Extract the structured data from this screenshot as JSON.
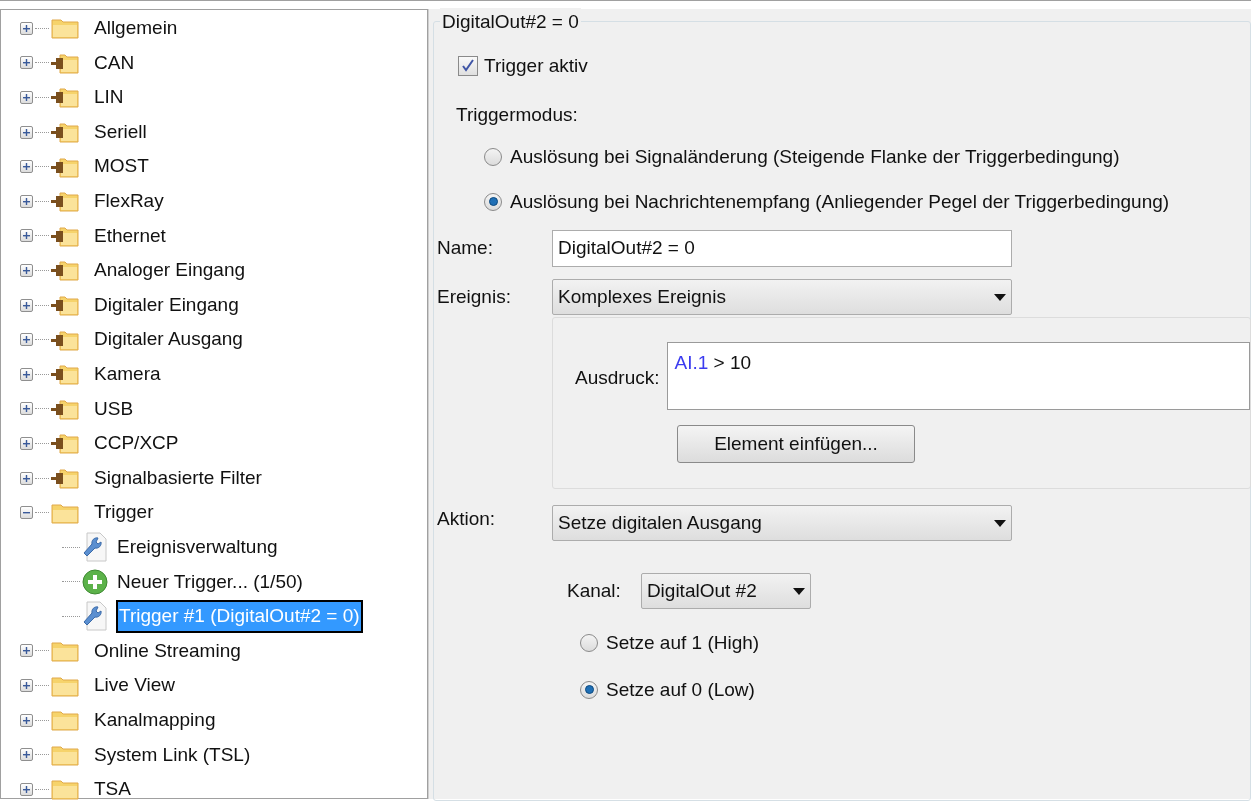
{
  "tree": [
    {
      "label": "Allgemein",
      "kind": "folder",
      "expanded": false,
      "selected": false
    },
    {
      "label": "CAN",
      "kind": "plug-folder",
      "expanded": false,
      "selected": false
    },
    {
      "label": "LIN",
      "kind": "plug-folder",
      "expanded": false,
      "selected": false
    },
    {
      "label": "Seriell",
      "kind": "plug-folder",
      "expanded": false,
      "selected": false
    },
    {
      "label": "MOST",
      "kind": "plug-folder",
      "expanded": false,
      "selected": false
    },
    {
      "label": "FlexRay",
      "kind": "plug-folder",
      "expanded": false,
      "selected": false
    },
    {
      "label": "Ethernet",
      "kind": "plug-folder",
      "expanded": false,
      "selected": false
    },
    {
      "label": "Analoger Eingang",
      "kind": "plug-folder",
      "expanded": false,
      "selected": false
    },
    {
      "label": "Digitaler Eingang",
      "kind": "plug-folder",
      "expanded": false,
      "selected": false
    },
    {
      "label": "Digitaler Ausgang",
      "kind": "plug-folder",
      "expanded": false,
      "selected": false
    },
    {
      "label": "Kamera",
      "kind": "plug-folder",
      "expanded": false,
      "selected": false
    },
    {
      "label": "USB",
      "kind": "plug-folder",
      "expanded": false,
      "selected": false
    },
    {
      "label": "CCP/XCP",
      "kind": "plug-folder",
      "expanded": false,
      "selected": false
    },
    {
      "label": "Signalbasierte Filter",
      "kind": "plug-folder",
      "expanded": false,
      "selected": false
    },
    {
      "label": "Trigger",
      "kind": "folder",
      "expanded": true,
      "selected": false,
      "children": [
        {
          "label": "Ereignisverwaltung",
          "kind": "wrench",
          "selected": false
        },
        {
          "label": "Neuer Trigger... (1/50)",
          "kind": "add",
          "selected": false
        },
        {
          "label": "Trigger #1 (DigitalOut#2 = 0)",
          "kind": "wrench",
          "selected": true
        }
      ]
    },
    {
      "label": "Online Streaming",
      "kind": "folder",
      "expanded": false,
      "selected": false
    },
    {
      "label": "Live View",
      "kind": "folder",
      "expanded": false,
      "selected": false
    },
    {
      "label": "Kanalmapping",
      "kind": "folder",
      "expanded": false,
      "selected": false
    },
    {
      "label": "System Link (TSL)",
      "kind": "folder",
      "expanded": false,
      "selected": false
    },
    {
      "label": "TSA",
      "kind": "folder",
      "expanded": false,
      "selected": false
    }
  ],
  "group": {
    "title": "DigitalOut#2 = 0",
    "trigger_active": {
      "label": "Trigger aktiv",
      "checked": true
    },
    "mode_label": "Triggermodus:",
    "modes": [
      {
        "label": "Auslösung bei Signaländerung (Steigende Flanke der Triggerbedingung)",
        "selected": false
      },
      {
        "label": "Auslösung bei Nachrichtenempfang (Anliegender Pegel der Triggerbedingung)",
        "selected": true
      }
    ],
    "name": {
      "label": "Name:",
      "value": "DigitalOut#2 = 0"
    },
    "event": {
      "label": "Ereignis:",
      "value": "Komplexes Ereignis"
    },
    "expression": {
      "label": "Ausdruck:",
      "tokens": [
        {
          "text": "AI.1",
          "kind": "signal"
        },
        {
          "text": " > 10",
          "kind": "plain"
        }
      ]
    },
    "insert_button": "Element einfügen...",
    "action": {
      "label": "Aktion:",
      "value": "Setze digitalen Ausgang"
    },
    "channel": {
      "label": "Kanal:",
      "value": "DigitalOut #2"
    },
    "outputs": [
      {
        "label": "Setze auf 1 (High)",
        "selected": false
      },
      {
        "label": "Setze auf 0 (Low)",
        "selected": true
      }
    ]
  }
}
